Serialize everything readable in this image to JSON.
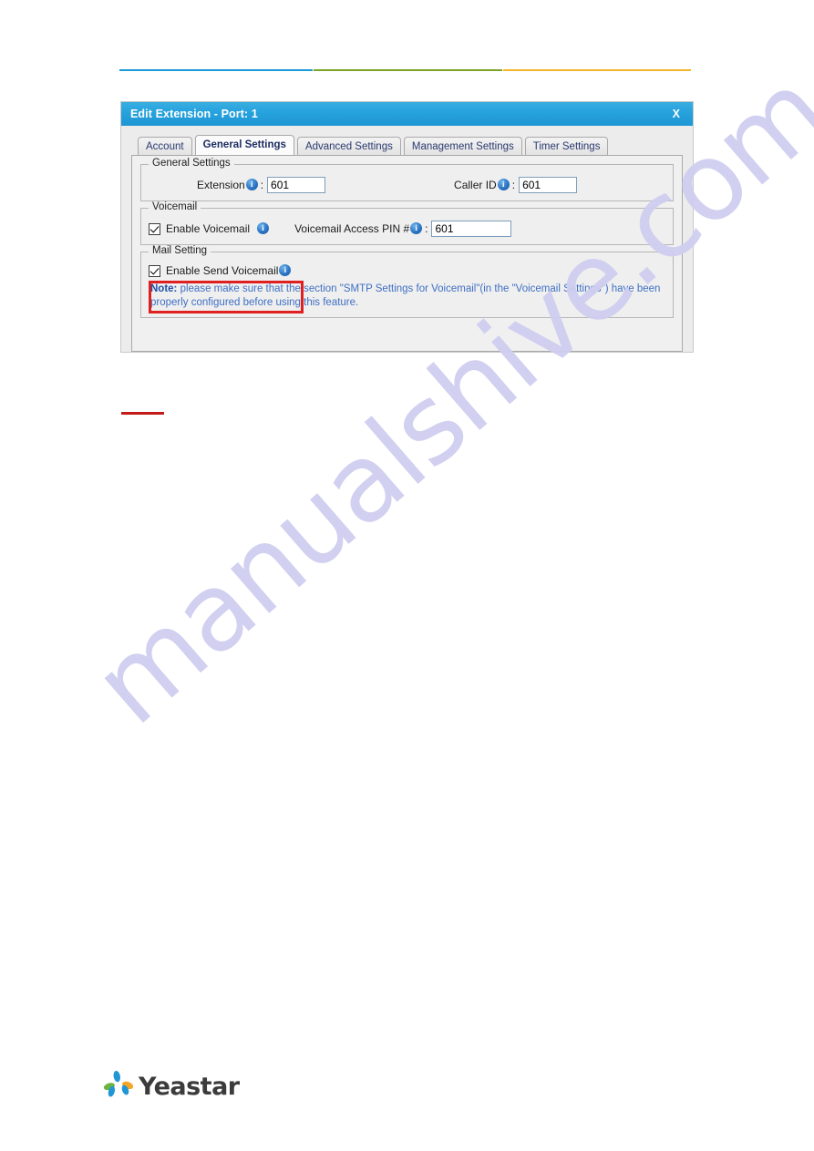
{
  "page": {
    "watermark_text": "manualshive.com",
    "rules": [
      {
        "name": "blue",
        "color": "#1b9bd8"
      },
      {
        "name": "green",
        "color": "#7ba428"
      },
      {
        "name": "orange",
        "color": "#f4b52c"
      }
    ],
    "red_mark_color": "#c31a1a"
  },
  "dialog": {
    "title": "Edit Extension - Port: 1",
    "close_label": "X",
    "titlebar_color": "#26a2dd",
    "tabs": [
      {
        "label": "Account",
        "active": false
      },
      {
        "label": "General Settings",
        "active": true
      },
      {
        "label": "Advanced Settings",
        "active": false
      },
      {
        "label": "Management Settings",
        "active": false
      },
      {
        "label": "Timer Settings",
        "active": false
      }
    ],
    "general_settings": {
      "legend": "General Settings",
      "extension": {
        "label": "Extension",
        "info_glyph": "i",
        "colon": ":",
        "value": "601"
      },
      "caller_id": {
        "label": "Caller ID",
        "info_glyph": "i",
        "colon": ":",
        "value": "601"
      }
    },
    "voicemail": {
      "legend": "Voicemail",
      "enable_voicemail": {
        "label": "Enable Voicemail",
        "checked": true,
        "info_glyph": "i"
      },
      "access_pin": {
        "label": "Voicemail Access PIN #",
        "info_glyph": "i",
        "colon": ":",
        "value": "601"
      }
    },
    "mail_setting": {
      "legend": "Mail Setting",
      "enable_send_voicemail": {
        "label": "Enable Send Voicemail",
        "checked": true,
        "info_glyph": "i"
      },
      "note_label": "Note:",
      "note_text": " please make sure that the section \"SMTP Settings for Voicemail\"(in the \"Voicemail Settings\") have been properly configured before using this feature.",
      "highlight_color": "#e02020"
    }
  },
  "footer": {
    "brand": "Yeastar"
  }
}
